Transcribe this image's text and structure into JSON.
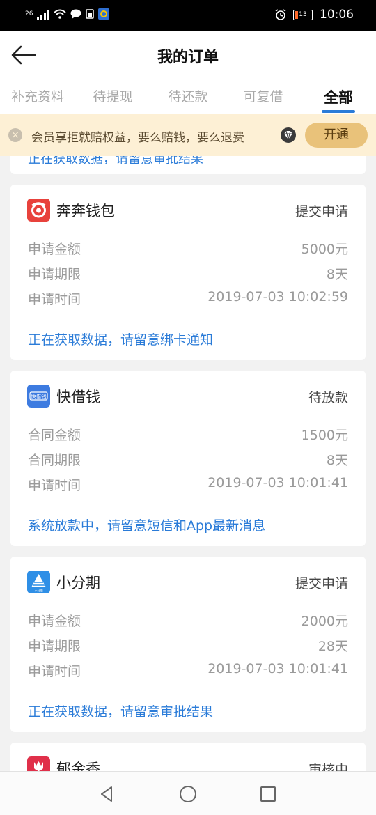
{
  "statusbar": {
    "network": "26",
    "time": "10:06",
    "battery": "13"
  },
  "header": {
    "title": "我的订单"
  },
  "tabs": [
    {
      "label": "补充资料"
    },
    {
      "label": "待提现"
    },
    {
      "label": "待还款"
    },
    {
      "label": "可复借"
    },
    {
      "label": "全部",
      "active": true
    }
  ],
  "banner": {
    "text": "会员享拒就赔权益，要么赔钱，要么退费",
    "button": "开通"
  },
  "partial_card": {
    "note": "正在获取数据，请留意审批结果"
  },
  "orders": [
    {
      "name": "奔奔钱包",
      "status": "提交申请",
      "logo_color": "#e8423c",
      "rows": [
        {
          "label": "申请金额",
          "value": "5000元"
        },
        {
          "label": "申请期限",
          "value": "8天"
        },
        {
          "label": "申请时间",
          "value": "2019-07-03 10:02:59"
        }
      ],
      "note": "正在获取数据，请留意绑卡通知"
    },
    {
      "name": "快借钱",
      "status": "待放款",
      "logo_color": "#3d7be0",
      "logo_text": "快借钱",
      "rows": [
        {
          "label": "合同金额",
          "value": "1500元"
        },
        {
          "label": "合同期限",
          "value": "8天"
        },
        {
          "label": "申请时间",
          "value": "2019-07-03 10:01:41"
        }
      ],
      "note": "系统放款中，请留意短信和App最新消息"
    },
    {
      "name": "小分期",
      "status": "提交申请",
      "logo_color": "#2f8fe6",
      "logo_text": "小分期",
      "rows": [
        {
          "label": "申请金额",
          "value": "2000元"
        },
        {
          "label": "申请期限",
          "value": "28天"
        },
        {
          "label": "申请时间",
          "value": "2019-07-03 10:01:41"
        }
      ],
      "note": "正在获取数据，请留意审批结果"
    },
    {
      "name": "郁金香",
      "status": "审核中",
      "logo_color": "#e0304a"
    }
  ],
  "colors": {
    "accent": "#2a7bd8",
    "banner_bg": "#fdf0d5",
    "banner_button": "#e9c27a"
  }
}
